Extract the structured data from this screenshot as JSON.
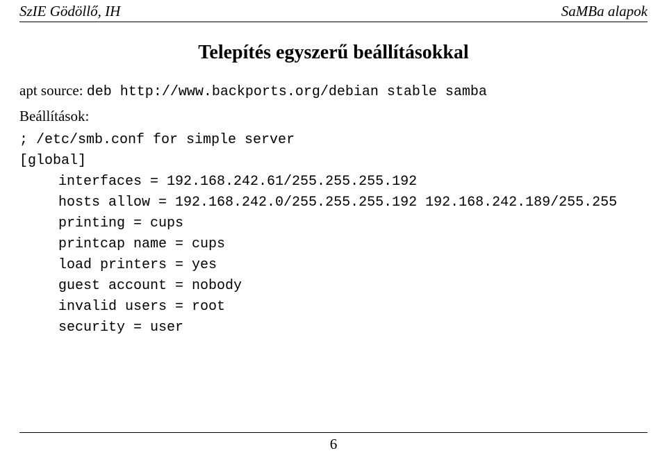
{
  "header": {
    "left": "SzIE Gödöllő, IH",
    "right": "SaMBa alapok"
  },
  "title": "Telepítés egyszerű beállításokkal",
  "apt_line": {
    "label": "apt source: ",
    "value": "deb http://www.backports.org/debian stable samba"
  },
  "settings_label": "Beállítások:",
  "config": {
    "comment": "; /etc/smb.conf for simple server",
    "section": "[global]",
    "lines": [
      "interfaces = 192.168.242.61/255.255.255.192",
      "hosts allow = 192.168.242.0/255.255.255.192 192.168.242.189/255.255",
      "printing = cups",
      "printcap name = cups",
      "load printers = yes",
      "guest account = nobody",
      "invalid users = root",
      "security = user"
    ]
  },
  "page_number": "6"
}
